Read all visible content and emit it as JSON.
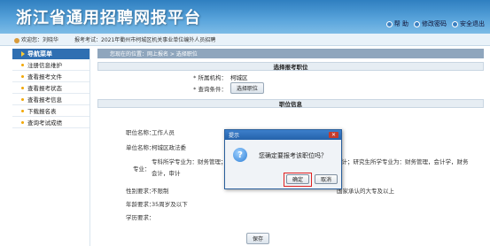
{
  "header": {
    "title": "浙江省通用招聘网报平台",
    "links": [
      {
        "label": "帮 助",
        "icon": "help-icon"
      },
      {
        "label": "修改密码",
        "icon": "key-icon"
      },
      {
        "label": "安全退出",
        "icon": "exit-icon"
      }
    ]
  },
  "infobar": {
    "welcome": "欢迎您：刘晓华",
    "exam": "报考考试：2021年衢州市柯城区机关事业单位编外人员招聘"
  },
  "sidebar": {
    "title": "导航菜单",
    "items": [
      {
        "label": "注册信息维护"
      },
      {
        "label": "查看报考文件"
      },
      {
        "label": "查看报考状态"
      },
      {
        "label": "查看报考信息"
      },
      {
        "label": "下载报名表"
      },
      {
        "label": "查询考试成绩"
      }
    ]
  },
  "main": {
    "breadcrumb": "您现在的位置：网上报名 > 选择职位",
    "select_section": "选择报考职位",
    "org_label": "* 所属机构：",
    "org_value": "柯城区",
    "cond_label": "* 查询条件：",
    "select_button": "选择职位",
    "info_section": "职位信息",
    "fields": [
      {
        "label": "职位名称：",
        "value": "工作人员"
      },
      {
        "label": "单位名称：",
        "value": "柯城区政法委"
      },
      {
        "label": "专业：",
        "value": "专科所学专业为：财务管理；本科所学专业为：会计学，财务管理，财务会计；研究生所学专业为：财务管理，会计学，财务会计，审计"
      },
      {
        "label": "性别要求：",
        "value": "不限制"
      },
      {
        "label": "年龄要求：",
        "value": "35周岁及以下"
      },
      {
        "label": "学历要求：",
        "value": "国家承认的大专及以上"
      }
    ],
    "save_button": "保存"
  },
  "dialog": {
    "title": "提示",
    "message": "您确定要报考该职位吗？",
    "ok": "确定",
    "cancel": "取消"
  },
  "colors": {
    "header": "#4a93d3",
    "nav_head": "#2f6fb2",
    "highlight": "#e02020"
  }
}
